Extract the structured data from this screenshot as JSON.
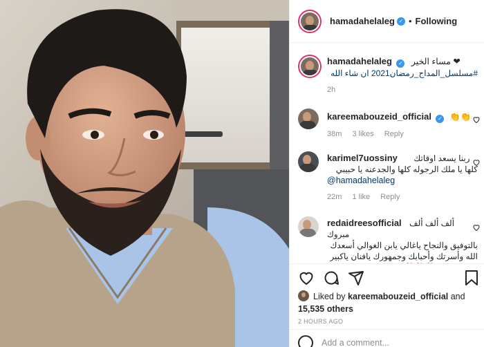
{
  "post": {
    "username": "hamadahelaleg",
    "follow_label": "Following",
    "caption_line1": "مساء الخير ❤",
    "caption_line2": "#مسلسل_المداح_رمضان2021 ان شاء الله",
    "caption_time": "2h"
  },
  "comments": [
    {
      "username": "kareemabouzeid_official",
      "text": "👏👏",
      "time": "38m",
      "likes": "3 likes",
      "reply": "Reply"
    },
    {
      "username": "karimel7uossiny",
      "text_line1": "ربنا يسعد اوقاتك",
      "text_line2": "كلها يا ملك الرجوله كلها والجدعنه يا حبيبي",
      "mention": "@hamadahelaleg",
      "time": "22m",
      "likes": "1 like",
      "reply": "Reply"
    },
    {
      "username": "redaidreesofficial",
      "text_line1": "ألف ألف ألف مبروك",
      "text_line2": "بالتوفيق والنجاح ياغالي يابن الغوالي أسعدك",
      "text_line3": "الله وأسرتك وأحبابك وجمهورك يافنان ياكبير",
      "text_line4": "❤❤❤❤❤❤💐💐💐"
    }
  ],
  "likes": {
    "prefix": "Liked by",
    "user": "kareemabouzeid_official",
    "and": "and",
    "count": "15,535 others"
  },
  "timestamp": "2 HOURS AGO",
  "add_comment_placeholder": "Add a comment...",
  "icons": {
    "verified": "verified-badge-icon",
    "like": "heart-icon",
    "comment": "comment-icon",
    "share": "share-icon",
    "save": "bookmark-icon",
    "emoji": "emoji-icon"
  },
  "colors": {
    "link": "#00376b",
    "verified": "#3897f0",
    "muted": "#8e8e8e",
    "story_ring": "#e1306c"
  }
}
